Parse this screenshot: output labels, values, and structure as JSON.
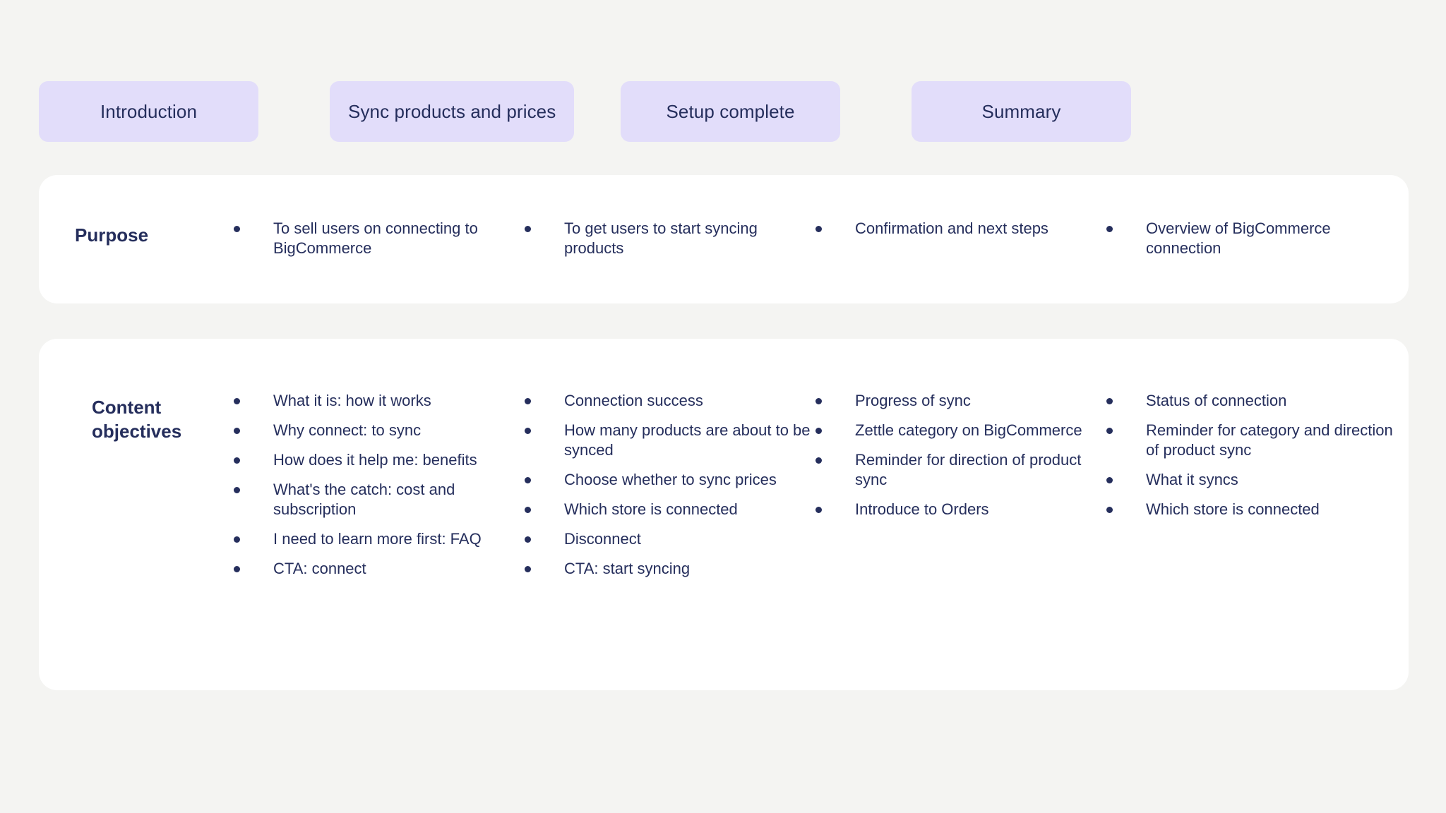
{
  "theme": {
    "page_background": "#f4f4f2",
    "card_background": "#ffffff",
    "chip_background": "#e2ddfa",
    "text_color": "#252e5c"
  },
  "stages": [
    {
      "label": "Introduction"
    },
    {
      "label": "Sync products and prices"
    },
    {
      "label": "Setup complete"
    },
    {
      "label": "Summary"
    }
  ],
  "rows": [
    {
      "label": "Purpose",
      "columns": [
        {
          "items": [
            "To sell users on connecting to BigCommerce"
          ]
        },
        {
          "items": [
            "To get users to start syncing products"
          ]
        },
        {
          "items": [
            "Confirmation and next steps"
          ]
        },
        {
          "items": [
            "Overview of BigCommerce connection"
          ]
        }
      ]
    },
    {
      "label": "Content objectives",
      "columns": [
        {
          "items": [
            "What it is: how it works",
            "Why connect: to sync",
            "How does it help me: benefits",
            "What's the catch: cost and subscription",
            "I need to learn more first: FAQ",
            "CTA: connect"
          ]
        },
        {
          "items": [
            "Connection success",
            "How many products are about to be synced",
            "Choose whether to sync prices",
            "Which store is connected",
            "Disconnect",
            "CTA: start syncing"
          ]
        },
        {
          "items": [
            "Progress of sync",
            "Zettle category on BigCommerce",
            "Reminder for direction of product sync",
            "Introduce to Orders"
          ]
        },
        {
          "items": [
            "Status of connection",
            "Reminder for category and direction of product sync",
            "What it syncs",
            "Which store is connected"
          ]
        }
      ]
    }
  ]
}
